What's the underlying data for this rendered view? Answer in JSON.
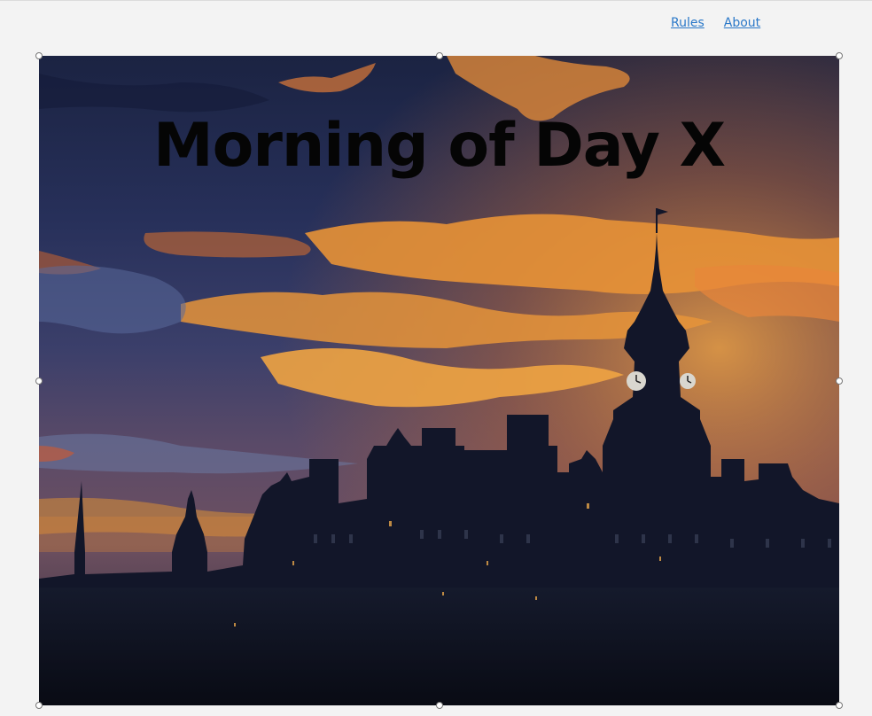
{
  "nav": {
    "rules": "Rules",
    "about": "About"
  },
  "scene": {
    "title": "Morning of Day X"
  },
  "colors": {
    "link": "#2a78c8",
    "page_background": "#f3f3f3",
    "sky_top": "#1f2746",
    "sunset_orange": "#e8902c",
    "silhouette": "#0f1220"
  }
}
